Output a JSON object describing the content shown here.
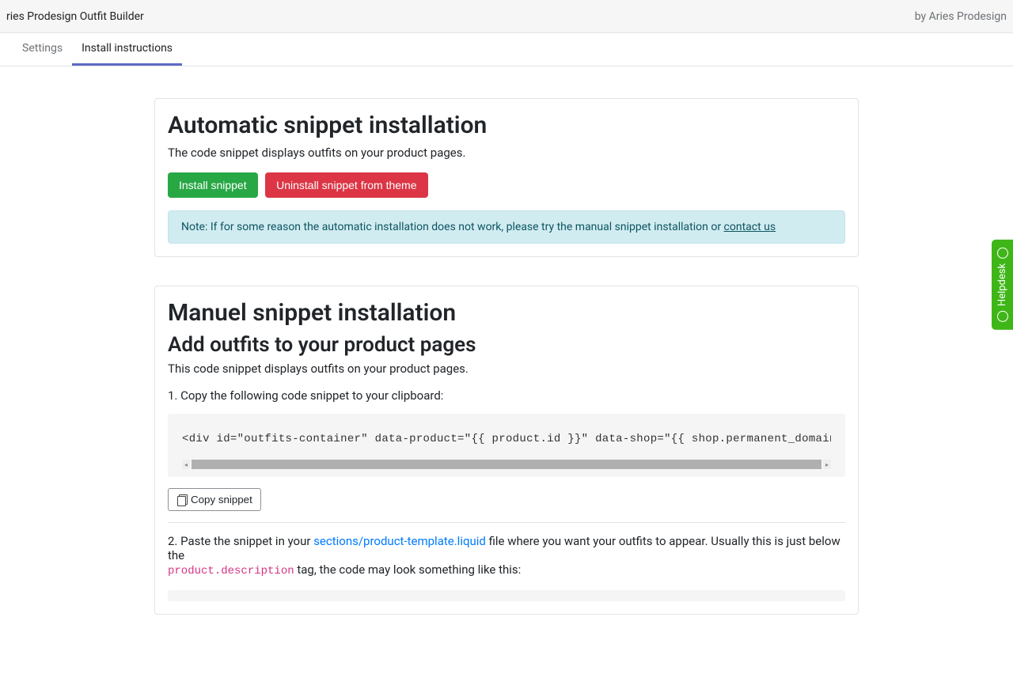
{
  "header": {
    "title_left": "ries Prodesign Outfit Builder",
    "title_right": "by Aries Prodesign"
  },
  "tabs": [
    {
      "label": "Settings",
      "active": false
    },
    {
      "label": "Install instructions",
      "active": true
    }
  ],
  "section_auto": {
    "title": "Automatic snippet installation",
    "desc": "The code snippet displays outfits on your product pages.",
    "install_btn": "Install snippet",
    "uninstall_btn": "Uninstall snippet from theme",
    "note_prefix": "Note: If for some reason the automatic installation does not work, please try the manual snippet installation or ",
    "contact_link": "contact us"
  },
  "section_manual": {
    "title": "Manuel snippet installation",
    "subtitle": "Add outfits to your product pages",
    "desc": "This code snippet displays outfits on your product pages.",
    "step1": "1. Copy the following code snippet to your clipboard:",
    "code": "<div id=\"outfits-container\" data-product=\"{{ product.id }}\" data-shop=\"{{ shop.permanent_domain }}\"></div>",
    "copy_btn": "Copy snippet",
    "step2_prefix": "2. Paste the snippet in your ",
    "step2_linkfile": "sections/product-template.liquid",
    "step2_mid": " file where you want your outfits to appear. Usually this is just below the ",
    "step2_code": "product.description",
    "step2_suffix": " tag, the code may look something like this:"
  },
  "helpdesk": {
    "label": "Helpdesk"
  }
}
